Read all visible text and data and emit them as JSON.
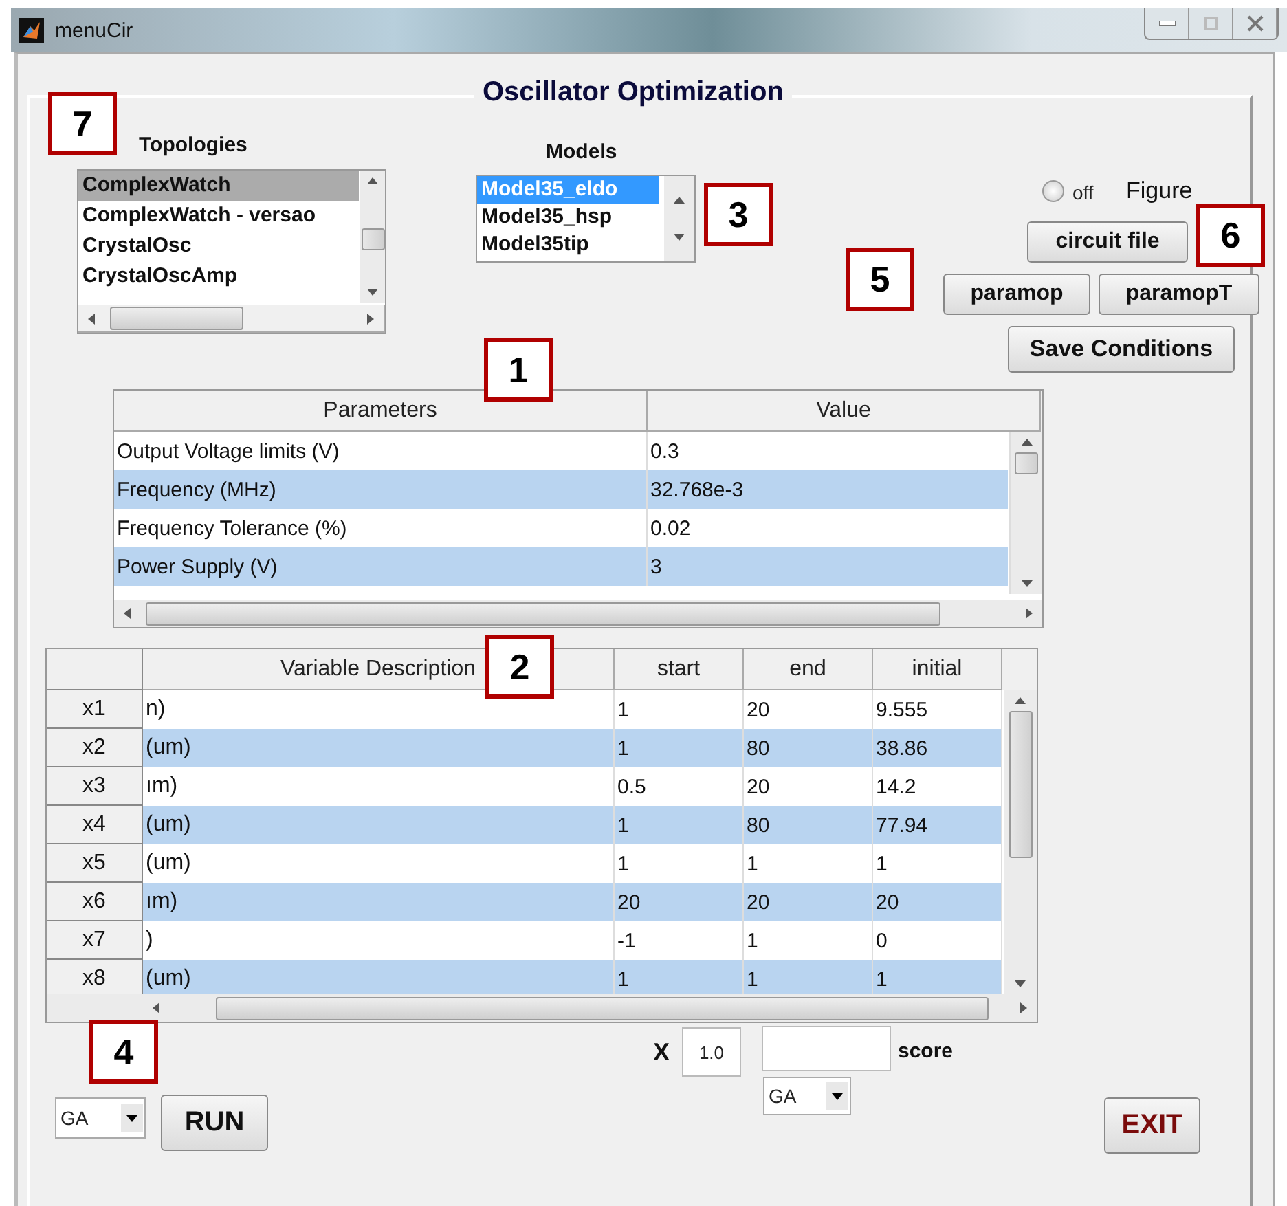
{
  "window": {
    "title": "menuCir"
  },
  "panel": {
    "title": "Oscillator Optimization"
  },
  "topologies": {
    "label": "Topologies",
    "items": [
      {
        "text": "ComplexWatch",
        "selected": true
      },
      {
        "text": "ComplexWatch - versao",
        "selected": false
      },
      {
        "text": "CrystalOsc",
        "selected": false
      },
      {
        "text": "CrystalOscAmp",
        "selected": false
      }
    ]
  },
  "models": {
    "label": "Models",
    "items": [
      {
        "text": "Model35_eldo",
        "selected": true
      },
      {
        "text": "Model35_hsp",
        "selected": false
      },
      {
        "text": "Model35tip",
        "selected": false
      }
    ]
  },
  "figure": {
    "radio_label": "off",
    "on": false,
    "label": "Figure"
  },
  "buttons": {
    "circuit_file": "circuit file",
    "paramop": "paramop",
    "paramopT": "paramopT",
    "save": "Save Conditions",
    "run": "RUN",
    "exit": "EXIT"
  },
  "parameters_table": {
    "columns": [
      "Parameters",
      "Value"
    ],
    "rows": [
      [
        "Output Voltage limits (V)",
        "0.3"
      ],
      [
        "Frequency (MHz)",
        "32.768e-3"
      ],
      [
        "Frequency Tolerance (%)",
        "0.02"
      ],
      [
        "Power Supply (V)",
        "3"
      ]
    ]
  },
  "variables_table": {
    "columns": [
      "Variable Description",
      "start",
      "end",
      "initial"
    ],
    "rows": [
      {
        "name": "x1",
        "cells": [
          "n)",
          "1",
          "20",
          "9.555"
        ]
      },
      {
        "name": "x2",
        "cells": [
          "(um)",
          "1",
          "80",
          "38.86"
        ]
      },
      {
        "name": "x3",
        "cells": [
          "ım)",
          "0.5",
          "20",
          "14.2"
        ]
      },
      {
        "name": "x4",
        "cells": [
          "(um)",
          "1",
          "80",
          "77.94"
        ]
      },
      {
        "name": "x5",
        "cells": [
          "(um)",
          "1",
          "1",
          "1"
        ]
      },
      {
        "name": "x6",
        "cells": [
          "ım)",
          "20",
          "20",
          "20"
        ]
      },
      {
        "name": "x7",
        "cells": [
          ")",
          "-1",
          "1",
          "0"
        ]
      },
      {
        "name": "x8",
        "cells": [
          "(um)",
          "1",
          "1",
          "1"
        ]
      }
    ]
  },
  "algorithm_left": {
    "value": "GA"
  },
  "factor": {
    "label": "X",
    "value": "1.0"
  },
  "score": {
    "label": "score"
  },
  "algorithm_right": {
    "value": "GA"
  },
  "callouts": [
    "7",
    "3",
    "1",
    "2",
    "6",
    "5",
    "4"
  ]
}
